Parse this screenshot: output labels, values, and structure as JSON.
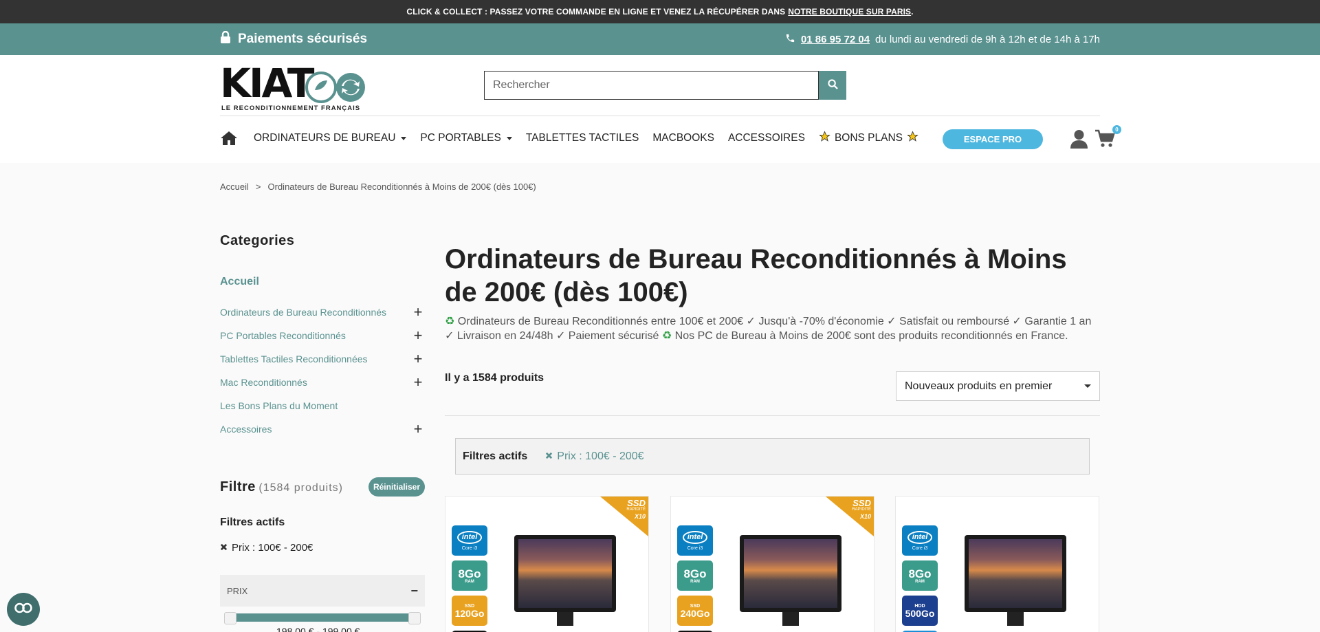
{
  "topbar": {
    "text": "CLICK & COLLECT : PASSEZ VOTRE COMMANDE EN LIGNE ET VENEZ LA RÉCUPÉRER DANS",
    "link": "NOTRE BOUTIQUE SUR PARIS",
    "end": "."
  },
  "infobar": {
    "secure": "Paiements sécurisés",
    "phone": "01 86 95 72 04",
    "hours": "du lundi au vendredi de 9h à 12h et de 14h à 17h"
  },
  "header": {
    "logo_word": "KIAT",
    "logo_tagline": "LE RECONDITIONNEMENT FRANÇAIS",
    "search_placeholder": "Rechercher",
    "nav": [
      "ORDINATEURS DE BUREAU",
      "PC PORTABLES",
      "TABLETTES TACTILES",
      "MACBOOKS",
      "ACCESSOIRES",
      "BONS PLANS"
    ],
    "pro_button": "ESPACE PRO",
    "cart_count": "0",
    "accent": "#5a9290",
    "pro_color": "#4eb7e0"
  },
  "breadcrumb": {
    "home": "Accueil",
    "sep": ">",
    "current": "Ordinateurs de Bureau Reconditionnés à Moins de 200€ (dès 100€)"
  },
  "sidebar": {
    "categories_title": "Categories",
    "home": "Accueil",
    "items": [
      {
        "label": "Ordinateurs de Bureau Reconditionnés",
        "expand": "+"
      },
      {
        "label": "PC Portables Reconditionnés",
        "expand": "+"
      },
      {
        "label": "Tablettes Tactiles Reconditionnées",
        "expand": "+"
      },
      {
        "label": "Mac Reconditionnés",
        "expand": "+"
      },
      {
        "label": "Les Bons Plans du Moment",
        "expand": ""
      },
      {
        "label": "Accessoires",
        "expand": "+"
      }
    ],
    "filter_title": "Filtre",
    "filter_count": "(1584 produits)",
    "reset": "Réinitialiser",
    "active_title": "Filtres actifs",
    "active_item": "Prix : 100€ - 200€",
    "price_label": "PRIX",
    "price_toggle": "−",
    "price_range": "198,00 € - 199,00 €"
  },
  "main": {
    "title": "Ordinateurs de Bureau Reconditionnés à Moins de 200€ (dès 100€)",
    "desc_1": "Ordinateurs de Bureau Reconditionnés entre 100€ et 200€ ✓ Jusqu'à -70% d'économie ✓ Satisfait ou remboursé ✓ Garantie 1 an ✓ Livraison en 24/48h ✓ Paiement sécurisé",
    "desc_2": "Nos PC de Bureau à Moins de 200€ sont des produits reconditionnés en France.",
    "count": "Il y a 1584 produits",
    "sort": "Nouveaux produits en premier",
    "active_label": "Filtres actifs",
    "active_value": "Prix : 100€ - 200€"
  },
  "products": [
    {
      "ribbon": "SSD",
      "ribbon_sub": "RAPIDITÉ",
      "ribbon_x": "X10",
      "cpu_brand": "intel",
      "cpu": "Core i3",
      "ram": "8Go",
      "ram_sub": "RAM",
      "storage": "120Go",
      "storage_type": "SSD"
    },
    {
      "ribbon": "SSD",
      "ribbon_sub": "RAPIDITÉ",
      "ribbon_x": "X10",
      "cpu_brand": "intel",
      "cpu": "Core i3",
      "ram": "8Go",
      "ram_sub": "RAM",
      "storage": "240Go",
      "storage_type": "SSD"
    },
    {
      "ribbon": "",
      "ribbon_sub": "",
      "ribbon_x": "",
      "cpu_brand": "intel",
      "cpu": "Core i3",
      "ram": "8Go",
      "ram_sub": "RAM",
      "storage": "500Go",
      "storage_type": "HDD"
    }
  ]
}
